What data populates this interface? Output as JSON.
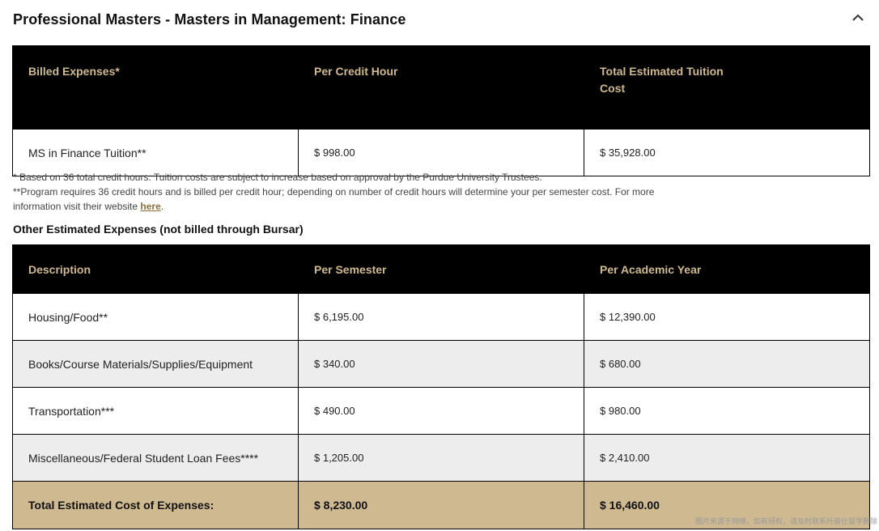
{
  "header": {
    "title": "Professional Masters - Masters in Management: Finance",
    "collapse_icon": "chevron-up-icon"
  },
  "tuition_table": {
    "headers": [
      "Billed Expenses*",
      "Per Credit Hour",
      "Total Estimated Tuition Cost"
    ],
    "rows": [
      [
        "MS in Finance Tuition**",
        "$ 998.00",
        "$ 35,928.00"
      ]
    ]
  },
  "notes": {
    "note1": "* Based on 36 total credit hours. Tuition costs are subject to increase based on approval by the Purdue University Trustees.",
    "note2_prefix": "**Program requires 36 credit hours and is billed per credit hour; depending on number of credit hours will determine your per semester cost. For more information visit their website ",
    "note2_link": "here",
    "note2_suffix": "."
  },
  "other_expenses": {
    "title": "Other Estimated Expenses (not billed through Bursar)",
    "headers": [
      "Description",
      "Per Semester",
      "Per Academic Year"
    ],
    "rows": [
      [
        "Housing/Food**",
        "$ 6,195.00",
        "$ 12,390.00"
      ],
      [
        "Books/Course Materials/Supplies/Equipment",
        "$ 340.00",
        "$ 680.00"
      ],
      [
        "Transportation***",
        "$ 490.00",
        "$ 980.00"
      ],
      [
        "Miscellaneous/Federal Student Loan Fees****",
        "$ 1,205.00",
        "$ 2,410.00"
      ]
    ],
    "total": [
      "Total Estimated Cost of Expenses:",
      "$ 8,230.00",
      "$ 16,460.00"
    ]
  },
  "watermark": "图片来源于网络，如有侵权，请及时联系托普仕留学删除",
  "colors": {
    "header_bg": "#000000",
    "header_text": "#cfb991",
    "total_row_bg": "#cfb991",
    "alt_row_bg": "#ededed",
    "link": "#8e6f3e"
  }
}
